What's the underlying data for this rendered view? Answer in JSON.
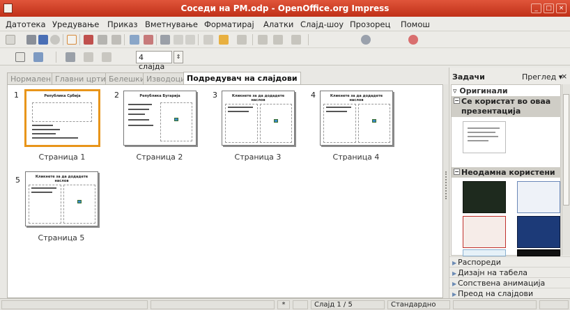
{
  "window": {
    "title": "Соседи на РМ.odp - OpenOffice.org Impress",
    "buttons": [
      "_",
      "□",
      "×"
    ]
  },
  "menubar": {
    "items": [
      "Датотека",
      "Уредување",
      "Приказ",
      "Вметнување",
      "Форматирај",
      "Алатки",
      "Слајд-шоу",
      "Прозорец",
      "Помош"
    ]
  },
  "toolbar2": {
    "slides_per_row": "4 слајда"
  },
  "tabs": [
    {
      "label": "Нормален",
      "active": false
    },
    {
      "label": "Главни црти",
      "active": false
    },
    {
      "label": "Белешки",
      "active": false
    },
    {
      "label": "Изводоци",
      "active": false
    },
    {
      "label": "Подредувач на слајдови",
      "active": true
    }
  ],
  "slides": [
    {
      "number": "1",
      "caption": "Страница 1",
      "thumb_title": "Република Србија",
      "selected": true
    },
    {
      "number": "2",
      "caption": "Страница 2",
      "thumb_title": "Република Бугарија",
      "selected": false
    },
    {
      "number": "3",
      "caption": "Страница 3",
      "thumb_title": "Кликнете за да додадете наслов",
      "selected": false
    },
    {
      "number": "4",
      "caption": "Страница 4",
      "thumb_title": "Кликнете за да додадете наслов",
      "selected": false
    },
    {
      "number": "5",
      "caption": "Страница 5",
      "thumb_title": "Кликнете за да додадете наслов",
      "selected": false
    }
  ],
  "taskpane": {
    "title": "Задачи",
    "view_label": "Преглед",
    "close": "×",
    "originals_label": "Оригинали",
    "used_label": "Се користат во оваа презентација",
    "recent_label": "Неодамна користени",
    "links": [
      "Распореди",
      "Дизајн на табела",
      "Сопствена анимација",
      "Преод на слајдови"
    ],
    "colors": {
      "accent": "#e8951a",
      "titlebar": "#c93a1f"
    }
  },
  "statusbar": {
    "modified": "*",
    "slide_position": "Слајд 1 / 5",
    "master_name": "Стандардно"
  }
}
